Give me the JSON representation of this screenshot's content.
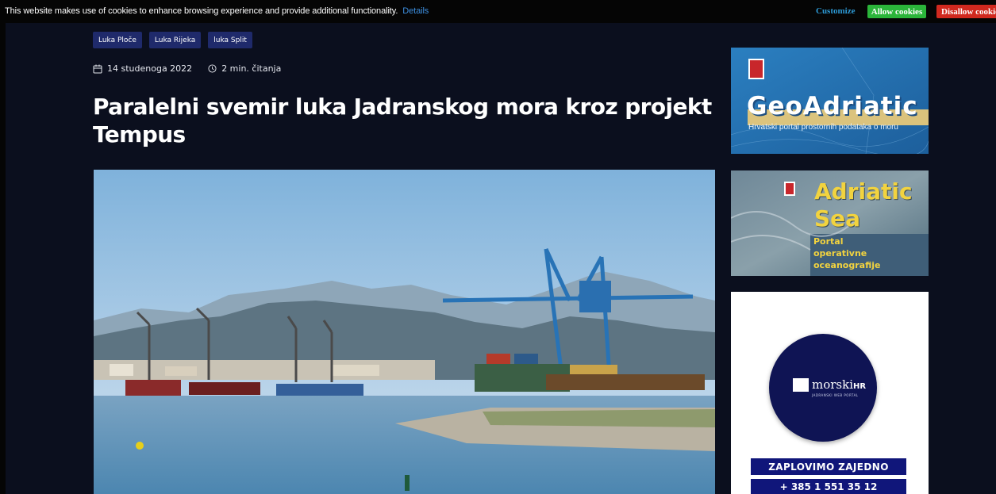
{
  "cookie_bar": {
    "message": "This website makes use of cookies to enhance browsing experience and provide additional functionality.",
    "details_label": "Details",
    "customize_label": "Customize",
    "allow_label": "Allow cookies",
    "disallow_label": "Disallow cookies"
  },
  "article": {
    "tags": [
      "Luka Ploče",
      "Luka Rijeka",
      "luka Split"
    ],
    "date": "14 studenoga 2022",
    "read_time": "2 min. čitanja",
    "title": "Paralelni svemir luka Jadranskog mora kroz projekt Tempus"
  },
  "ads": {
    "geoadriatic": {
      "title": "GeoAdriatic",
      "subtitle": "Hrvatski portal prostornih podataka o moru"
    },
    "adriatic_sea": {
      "line1": "Adriatic",
      "line2": "Sea",
      "line3": "Portal",
      "line4": "operativne",
      "line5": "oceanografije"
    },
    "morski": {
      "logo_text": "morski",
      "logo_suffix": "HR",
      "logo_tagline": "JADRANSKI WEB PORTAL",
      "slogan": "ZAPLOVIMO ZAJEDNO",
      "phone": "+ 385 1 551 35 12"
    }
  },
  "colors": {
    "background": "#0b0f1e",
    "tag_bg": "#1f2a6b",
    "allow": "#2bb53a",
    "disallow": "#d1291f",
    "link": "#3d8fe0"
  }
}
